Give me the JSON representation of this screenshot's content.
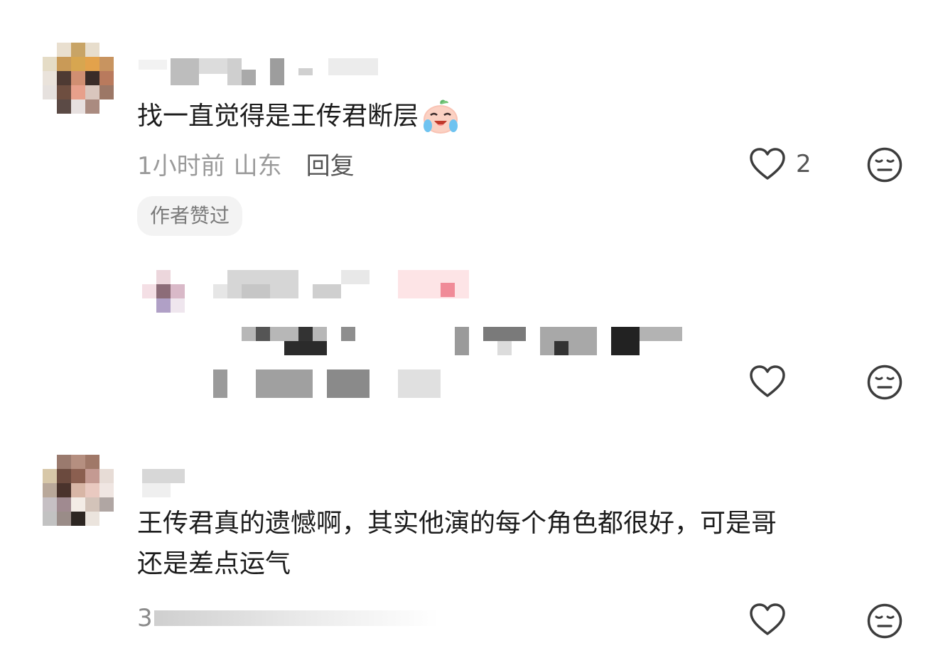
{
  "comments": [
    {
      "text": "找一直觉得是王传君断层",
      "emoji": "crying-laughing-peach-emoji",
      "time": "1小时前",
      "location": "山东",
      "reply_label": "回复",
      "like_count": "2",
      "author_liked_tag": "作者赞过"
    },
    {
      "text_line1": "王传君真的遗憾啊，其实他演的每个角色都很好，可是哥",
      "text_line2": "还是差点运气",
      "partial_meta": "3"
    }
  ],
  "icons": {
    "like": "heart-outline-icon",
    "dislike": "neutral-face-icon"
  },
  "colors": {
    "text": "#1c1c1c",
    "meta": "#9a9a9a",
    "icon": "#3c3c3c",
    "tag_bg": "#f3f3f3",
    "pixelate_pink": "#f08b98"
  }
}
